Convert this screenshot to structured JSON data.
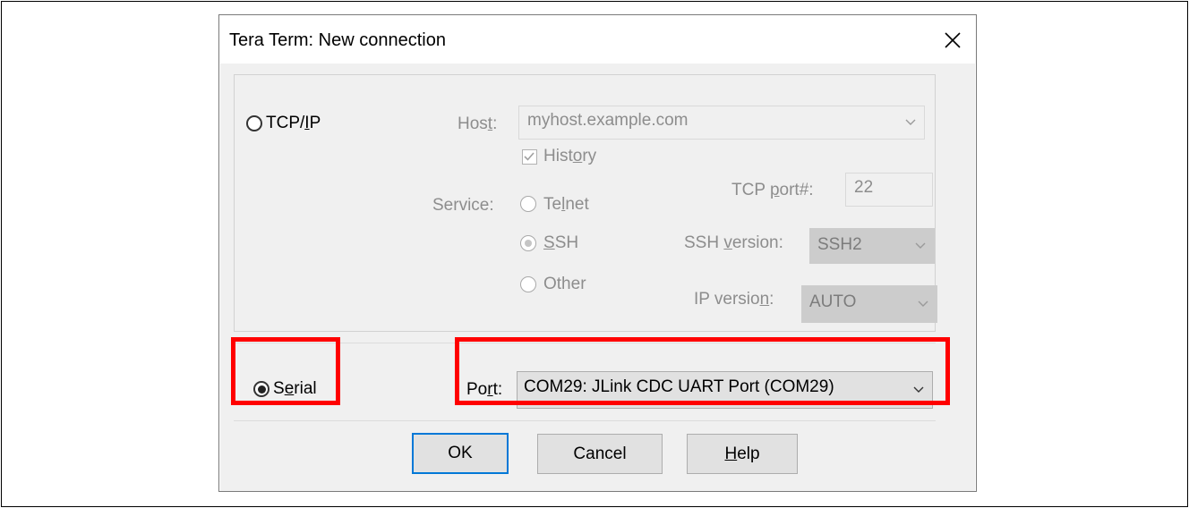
{
  "window": {
    "title": "Tera Term: New connection"
  },
  "tcpip": {
    "radio_label_pre": "TCP/",
    "radio_label_u": "I",
    "radio_label_post": "P",
    "host_label_pre": "Hos",
    "host_label_u": "t",
    "host_label_post": ":",
    "host_value": "myhost.example.com",
    "history_pre": "Hist",
    "history_u": "o",
    "history_post": "ry",
    "history_checked": true,
    "service_label": "Service:",
    "service_options": {
      "telnet_pre": "Te",
      "telnet_u": "l",
      "telnet_post": "net",
      "ssh_pre": "",
      "ssh_u": "S",
      "ssh_post": "SH",
      "other": "Other"
    },
    "service_selected": "SSH",
    "tcp_port_pre": "TCP ",
    "tcp_port_u": "p",
    "tcp_port_post": "ort#:",
    "tcp_port_value": "22",
    "ssh_version_pre": "SSH ",
    "ssh_version_u": "v",
    "ssh_version_post": "ersion:",
    "ssh_version_value": "SSH2",
    "ip_version_pre": "IP versio",
    "ip_version_u": "n",
    "ip_version_post": ":",
    "ip_version_value": "AUTO"
  },
  "serial": {
    "radio_label_pre": "S",
    "radio_label_u": "e",
    "radio_label_post": "rial",
    "selected": true,
    "port_label_pre": "Po",
    "port_label_u": "r",
    "port_label_post": "t:",
    "port_value": "COM29: JLink CDC UART Port (COM29)"
  },
  "buttons": {
    "ok": "OK",
    "cancel": "Cancel",
    "help_u": "H",
    "help_post": "elp"
  },
  "colors": {
    "highlight": "#ff0000",
    "default_button_border": "#0078d7",
    "dialog_bg": "#f0f0f0"
  },
  "icons": {
    "close": "close-icon",
    "dropdown": "chevron-down-icon"
  }
}
